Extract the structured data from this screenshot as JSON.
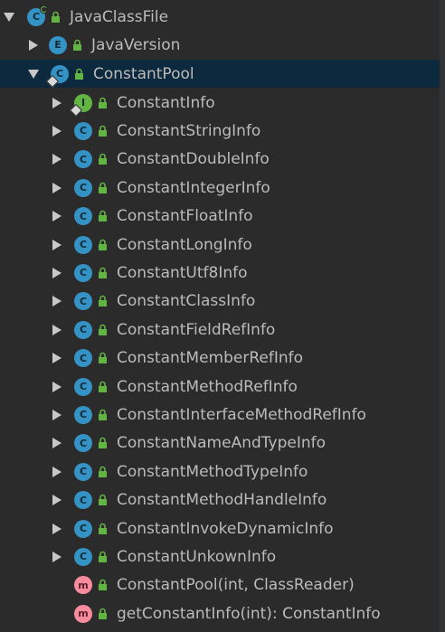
{
  "colors": {
    "background": "#2b2b2b",
    "selection": "#0d293e",
    "text": "#bbbbbb",
    "class_badge": "#3592c4",
    "interface_badge": "#62b543",
    "method_badge": "#f98b9e",
    "lock": "#62b543"
  },
  "tree": {
    "root": {
      "label": "JavaClassFile",
      "expanded": true,
      "icon": "class-icon"
    },
    "java_version": {
      "label": "JavaVersion",
      "expanded": false,
      "icon": "enum-icon"
    },
    "constant_pool": {
      "label": "ConstantPool",
      "expanded": true,
      "selected": true,
      "icon": "class-icon"
    },
    "children": [
      {
        "label": "ConstantInfo",
        "icon": "interface-icon",
        "letter": "I"
      },
      {
        "label": "ConstantStringInfo",
        "icon": "class-icon",
        "letter": "C"
      },
      {
        "label": "ConstantDoubleInfo",
        "icon": "class-icon",
        "letter": "C"
      },
      {
        "label": "ConstantIntegerInfo",
        "icon": "class-icon",
        "letter": "C"
      },
      {
        "label": "ConstantFloatInfo",
        "icon": "class-icon",
        "letter": "C"
      },
      {
        "label": "ConstantLongInfo",
        "icon": "class-icon",
        "letter": "C"
      },
      {
        "label": "ConstantUtf8Info",
        "icon": "class-icon",
        "letter": "C"
      },
      {
        "label": "ConstantClassInfo",
        "icon": "class-icon",
        "letter": "C"
      },
      {
        "label": "ConstantFieldRefInfo",
        "icon": "class-icon",
        "letter": "C"
      },
      {
        "label": "ConstantMemberRefInfo",
        "icon": "class-icon",
        "letter": "C"
      },
      {
        "label": "ConstantMethodRefInfo",
        "icon": "class-icon",
        "letter": "C"
      },
      {
        "label": "ConstantInterfaceMethodRefInfo",
        "icon": "class-icon",
        "letter": "C"
      },
      {
        "label": "ConstantNameAndTypeInfo",
        "icon": "class-icon",
        "letter": "C"
      },
      {
        "label": "ConstantMethodTypeInfo",
        "icon": "class-icon",
        "letter": "C"
      },
      {
        "label": "ConstantMethodHandleInfo",
        "icon": "class-icon",
        "letter": "C"
      },
      {
        "label": "ConstantInvokeDynamicInfo",
        "icon": "class-icon",
        "letter": "C"
      },
      {
        "label": "ConstantUnkownInfo",
        "icon": "class-icon",
        "letter": "C"
      }
    ],
    "methods": [
      {
        "label": "ConstantPool(int, ClassReader)",
        "icon": "method-icon",
        "letter": "m"
      },
      {
        "label": "getConstantInfo(int): ConstantInfo",
        "icon": "method-icon",
        "letter": "m"
      }
    ]
  }
}
